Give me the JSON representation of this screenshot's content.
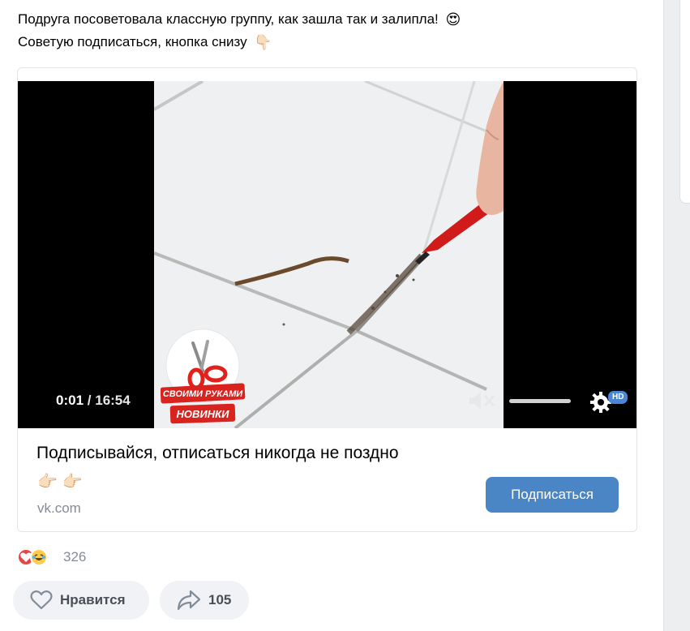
{
  "post": {
    "text_line1": "Подруга посоветовала классную группу, как зашла так и залипла!",
    "text_line1_emoji": "😍",
    "text_line2": "Советую подписаться, кнопка снизу",
    "text_line2_emoji": "👇🏻"
  },
  "video": {
    "current_time": "0:01",
    "separator": "/",
    "duration": "16:54",
    "hd_label": "HD",
    "logo": {
      "line1": "СВОИМИ РУКАМИ",
      "line2": "НОВИНКИ"
    }
  },
  "snippet": {
    "title": "Подписывайся, отписаться никогда не поздно",
    "emojis": "👉🏻👉🏻",
    "domain": "vk.com",
    "subscribe_label": "Подписаться"
  },
  "reactions": {
    "count": "326"
  },
  "actions": {
    "like_label": "Нравится",
    "share_count": "105"
  },
  "colors": {
    "accent": "#4a86c6",
    "page_bg": "#edeef0",
    "secondary_text": "#818c99"
  },
  "icons": {
    "mute": "mute-icon",
    "settings": "gear-icon",
    "like": "heart-outline-icon",
    "share": "share-arrow-icon",
    "reaction1": "heart-reaction-icon",
    "reaction2": "laughing-reaction-icon"
  }
}
